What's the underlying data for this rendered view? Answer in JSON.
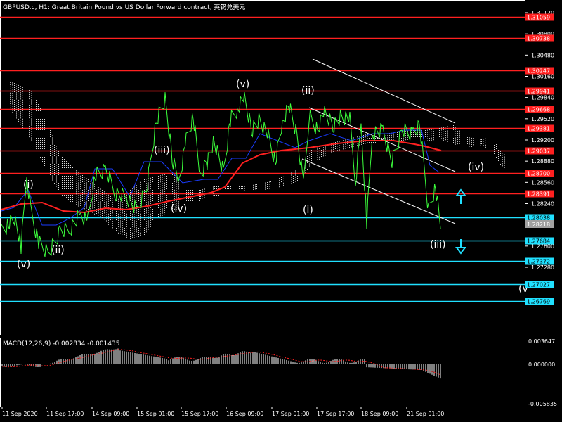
{
  "header": {
    "title": "GBPUSD.c, H1:  Great Britain Pound vs US Dollar Forward contract, 英镑兑美元"
  },
  "macd": {
    "label": "MACD(12,26,9) -0.002834 -0.001435",
    "axis_ticks": [
      "0.003647",
      "0.000000",
      "-0.005835"
    ]
  },
  "price_axis": {
    "ticks": [
      "1.31120",
      "1.30800",
      "1.30480",
      "1.30160",
      "1.29840",
      "1.29520",
      "1.29200",
      "1.28880",
      "1.28560",
      "1.28240",
      "1.27920",
      "1.27600",
      "1.27280"
    ],
    "current_price": "1.28218"
  },
  "levels": [
    {
      "label": "1.31376",
      "kind": "resistance",
      "color": "#ff2020"
    },
    {
      "label": "1.31059",
      "kind": "resistance",
      "color": "#ff2020"
    },
    {
      "label": "1.30738",
      "kind": "resistance",
      "color": "#ff2020"
    },
    {
      "label": "1.30247",
      "kind": "resistance",
      "color": "#ff2020"
    },
    {
      "label": "1.29941",
      "kind": "resistance",
      "color": "#ff2020"
    },
    {
      "label": "1.29668",
      "kind": "resistance",
      "color": "#ff2020"
    },
    {
      "label": "1.29381",
      "kind": "resistance",
      "color": "#ff2020"
    },
    {
      "label": "1.29037",
      "kind": "resistance",
      "color": "#ff2020"
    },
    {
      "label": "1.28700",
      "kind": "resistance",
      "color": "#ff2020"
    },
    {
      "label": "1.28391",
      "kind": "resistance",
      "color": "#ff2020"
    },
    {
      "label": "1.28038",
      "kind": "support",
      "color": "#20e0ff"
    },
    {
      "label": "1.27684",
      "kind": "support",
      "color": "#20e0ff"
    },
    {
      "label": "1.27372",
      "kind": "support",
      "color": "#20e0ff"
    },
    {
      "label": "1.27027",
      "kind": "support",
      "color": "#20e0ff"
    },
    {
      "label": "1.26769",
      "kind": "support",
      "color": "#20e0ff"
    }
  ],
  "time_axis": [
    "11 Sep 2020",
    "11 Sep 17:00",
    "14 Sep 09:00",
    "15 Sep 01:00",
    "15 Sep 17:00",
    "16 Sep 09:00",
    "17 Sep 01:00",
    "17 Sep 17:00",
    "18 Sep 09:00",
    "21 Sep 01:00"
  ],
  "wave_labels": [
    "(v)",
    "(i)",
    "(ii)",
    "(iii)",
    "(iv)",
    "(v)",
    "(ii)",
    "(i)",
    "(iii)",
    "(iv)",
    "(v"
  ],
  "colors": {
    "background": "#000000",
    "price_line": "#3cff3c",
    "resistance": "#ff2020",
    "support": "#20e0ff",
    "moving_average": "#ff2020",
    "kijun": "#1a3cff",
    "cloud": "#ffffff",
    "channel": "#ffffff",
    "macd_hist": "#ffffff",
    "macd_signal": "#ff2020",
    "arrow": "#20e0ff"
  },
  "icons": [
    "arrow-up-icon",
    "arrow-down-icon"
  ]
}
